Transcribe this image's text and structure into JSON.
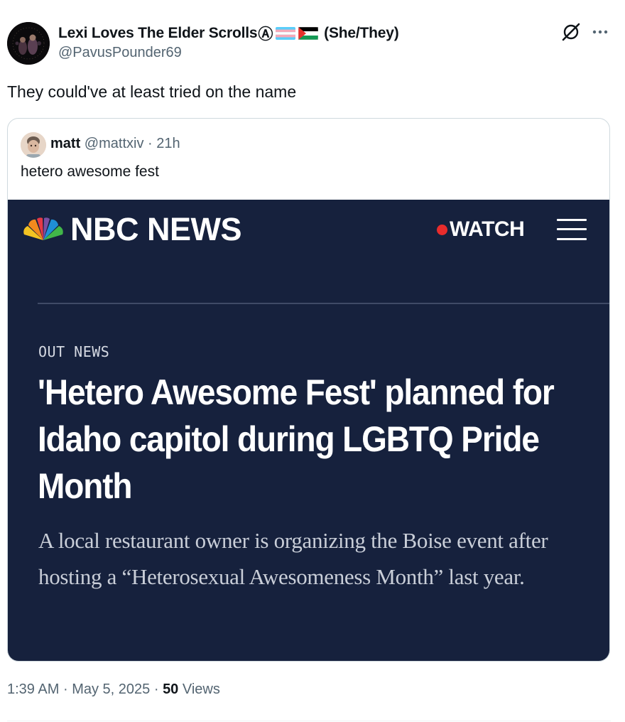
{
  "author": {
    "name": "Lexi Loves The Elder Scrolls",
    "anarchy_symbol": "Ⓐ",
    "pronouns": "(She/They)",
    "handle": "@PavusPounder69",
    "icons": [
      "avatar",
      "trans-flag-icon",
      "palestine-flag-icon"
    ]
  },
  "actions": {
    "grok_icon": "grok-icon",
    "more_icon": "more-icon"
  },
  "post": {
    "text": "They could've at least tried on the name"
  },
  "quote": {
    "name": "matt",
    "handle": "@mattxiv",
    "separator": "·",
    "time": "21h",
    "text": "hetero awesome fest",
    "image": {
      "brand": "NBC NEWS",
      "watch_label": "WATCH",
      "category": "OUT NEWS",
      "headline": "'Hetero Awesome Fest' planned for Idaho capitol during LGBTQ Pride Month",
      "subhead": "A local restaurant owner is organizing the Boise event after hosting a “Heterosexual Awesomeness Month” last year.",
      "colors": {
        "background": "#16213d",
        "watch_dot": "#e82c2c"
      }
    }
  },
  "footer": {
    "time": "1:39 AM",
    "sep1": "·",
    "date": "May 5, 2025",
    "sep2": "·",
    "views_count": "50",
    "views_label": "Views"
  }
}
